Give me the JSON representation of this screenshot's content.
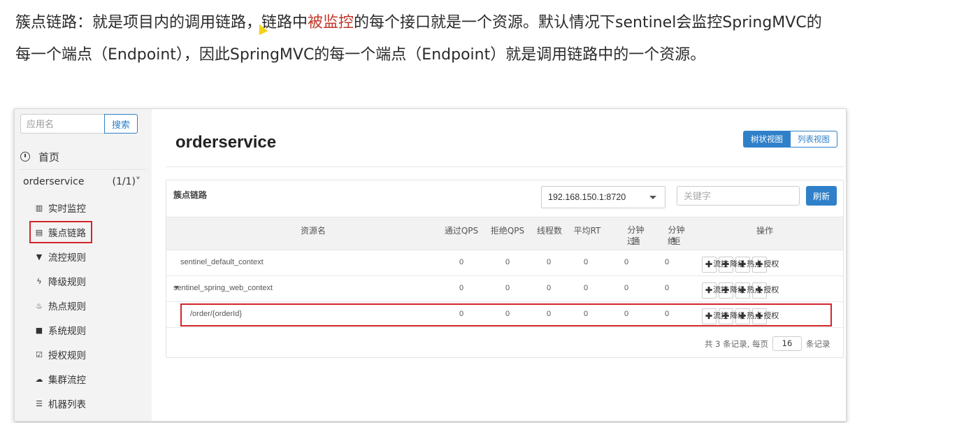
{
  "intro": {
    "line1_a": "簇点链路：就是项目内的调用链路，链路中",
    "line1_hl": "被监控",
    "line1_b": "的每个接口就是一个资源。默认情况下sentinel会监控SpringMVC的",
    "line2": "每一个端点（Endpoint），因此SpringMVC的每一个端点（Endpoint）就是调用链路中的一个资源。"
  },
  "sidebar": {
    "search_placeholder": "应用名",
    "search_button": "搜索",
    "home_label": "首页",
    "app_name": "orderservice",
    "app_count": "(1/1)",
    "app_chevron": "˅",
    "items": [
      {
        "label": "实时监控",
        "icon": "bar-chart-icon"
      },
      {
        "label": "簇点链路",
        "icon": "list-icon"
      },
      {
        "label": "流控规则",
        "icon": "filter-icon"
      },
      {
        "label": "降级规则",
        "icon": "bolt-icon"
      },
      {
        "label": "热点规则",
        "icon": "fire-icon"
      },
      {
        "label": "系统规则",
        "icon": "lock-icon"
      },
      {
        "label": "授权规则",
        "icon": "check-square-icon"
      },
      {
        "label": "集群流控",
        "icon": "cloud-icon"
      },
      {
        "label": "机器列表",
        "icon": "list-ul-icon"
      }
    ]
  },
  "main": {
    "title": "orderservice",
    "view_tree": "树状视图",
    "view_list": "列表视图",
    "panel_title": "簇点链路",
    "machine": "192.168.150.1:8720",
    "keyword_placeholder": "关键字",
    "refresh": "刷新",
    "columns": [
      "资源名",
      "通过QPS",
      "拒绝QPS",
      "线程数",
      "平均RT",
      "分钟通过",
      "分钟拒绝",
      "操作"
    ],
    "col_min_pass": [
      "分钟通",
      "过"
    ],
    "col_min_block": [
      "分钟拒",
      "绝"
    ],
    "rows": [
      {
        "name": "sentinel_default_context",
        "pass_qps": "0",
        "block_qps": "0",
        "threads": "0",
        "avg_rt": "0",
        "min_pass": "0",
        "min_block": "0"
      },
      {
        "name": "sentinel_spring_web_context",
        "toggle": "▼",
        "pass_qps": "0",
        "block_qps": "0",
        "threads": "0",
        "avg_rt": "0",
        "min_pass": "0",
        "min_block": "0"
      },
      {
        "name": "/order/{orderId}",
        "pass_qps": "0",
        "block_qps": "0",
        "threads": "0",
        "avg_rt": "0",
        "min_pass": "0",
        "min_block": "0"
      }
    ],
    "ops": [
      "流控",
      "降级",
      "热点",
      "授权"
    ],
    "ops_plus": "✚",
    "pager": {
      "prefix": "共 3 条记录, 每页",
      "page_size": "16",
      "suffix": "条记录"
    }
  },
  "colors": {
    "accent": "#2f80c9",
    "highlight_red": "#d2262b",
    "intro_red": "#c0392b"
  }
}
